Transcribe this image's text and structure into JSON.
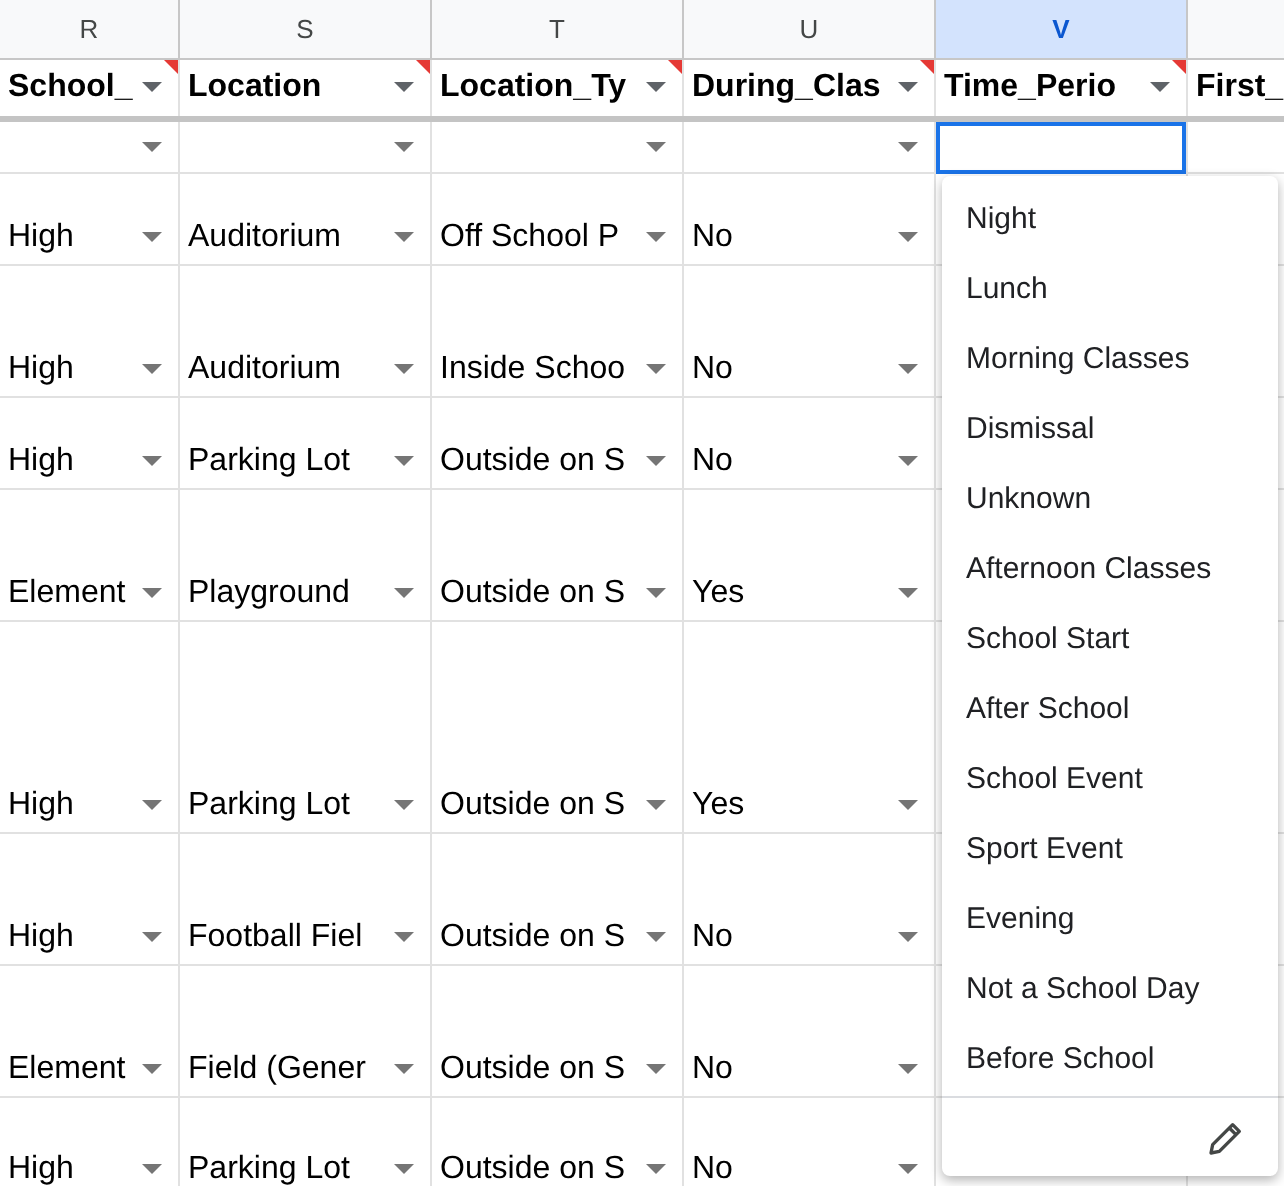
{
  "columns": [
    {
      "letter": "R",
      "heading": "School_",
      "selected": false
    },
    {
      "letter": "S",
      "heading": "Location",
      "selected": false
    },
    {
      "letter": "T",
      "heading": "Location_Ty",
      "selected": false
    },
    {
      "letter": "U",
      "heading": "During_Clas",
      "selected": false
    },
    {
      "letter": "V",
      "heading": "Time_Perio",
      "selected": true
    },
    {
      "heading": "First_",
      "selected": false
    }
  ],
  "rows": [
    [
      "High",
      "Auditorium",
      "Off School P",
      "No"
    ],
    [
      "High",
      "Auditorium",
      "Inside Schoo",
      "No"
    ],
    [
      "High",
      "Parking Lot",
      "Outside on S",
      "No"
    ],
    [
      "Element",
      "Playground",
      "Outside on S",
      "Yes"
    ],
    [
      "High",
      "Parking Lot",
      "Outside on S",
      "Yes"
    ],
    [
      "High",
      "Football Fiel",
      "Outside on S",
      "No"
    ],
    [
      "Element",
      "Field (Gener",
      "Outside on S",
      "No"
    ],
    [
      "High",
      "Parking Lot",
      "Outside on S",
      "No"
    ]
  ],
  "dropdown": {
    "options": [
      "Night",
      "Lunch",
      "Morning Classes",
      "Dismissal",
      "Unknown",
      "Afternoon Classes",
      "School Start",
      "After School",
      "School Event",
      "Sport Event",
      "Evening",
      "Not a School Day",
      "Before School"
    ]
  }
}
